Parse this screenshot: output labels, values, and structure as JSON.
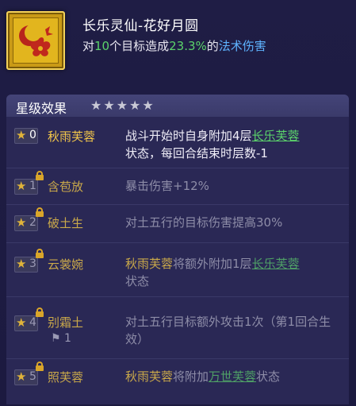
{
  "skill": {
    "name": "长乐灵仙-花好月圆",
    "desc": {
      "prefix": "对",
      "targets": "10",
      "middle": "个目标造成",
      "percent": "23.3%",
      "suffix": "的",
      "damage_type": "法术伤害"
    }
  },
  "panel": {
    "title": "星级效果",
    "stars_count": 5
  },
  "rows": [
    {
      "level": "0",
      "name": "秋雨芙蓉",
      "locked": false,
      "active": true,
      "desc_a": "战斗开始时自身附加4层",
      "desc_link": "长乐芙蓉",
      "desc_b": "状态，每回合结束时层数-1"
    },
    {
      "level": "1",
      "name": "含苞放",
      "locked": true,
      "desc": "暴击伤害+12%"
    },
    {
      "level": "2",
      "name": "破土生",
      "locked": true,
      "desc": "对土五行的目标伤害提高30%"
    },
    {
      "level": "3",
      "name": "云裳婉",
      "locked": true,
      "desc_gold": "秋雨芙蓉",
      "desc_a": "将额外附加1层",
      "desc_link": "长乐芙蓉",
      "desc_b": "状态"
    },
    {
      "level": "4",
      "name": "别霜土",
      "locked": true,
      "flag": "1",
      "desc": "对土五行目标额外攻击1次（第1回合生效）"
    },
    {
      "level": "5",
      "name": "照芙蓉",
      "locked": true,
      "desc_gold": "秋雨芙蓉",
      "desc_a": "将附加",
      "desc_link": "万世芙蓉",
      "desc_b": "状态"
    }
  ]
}
